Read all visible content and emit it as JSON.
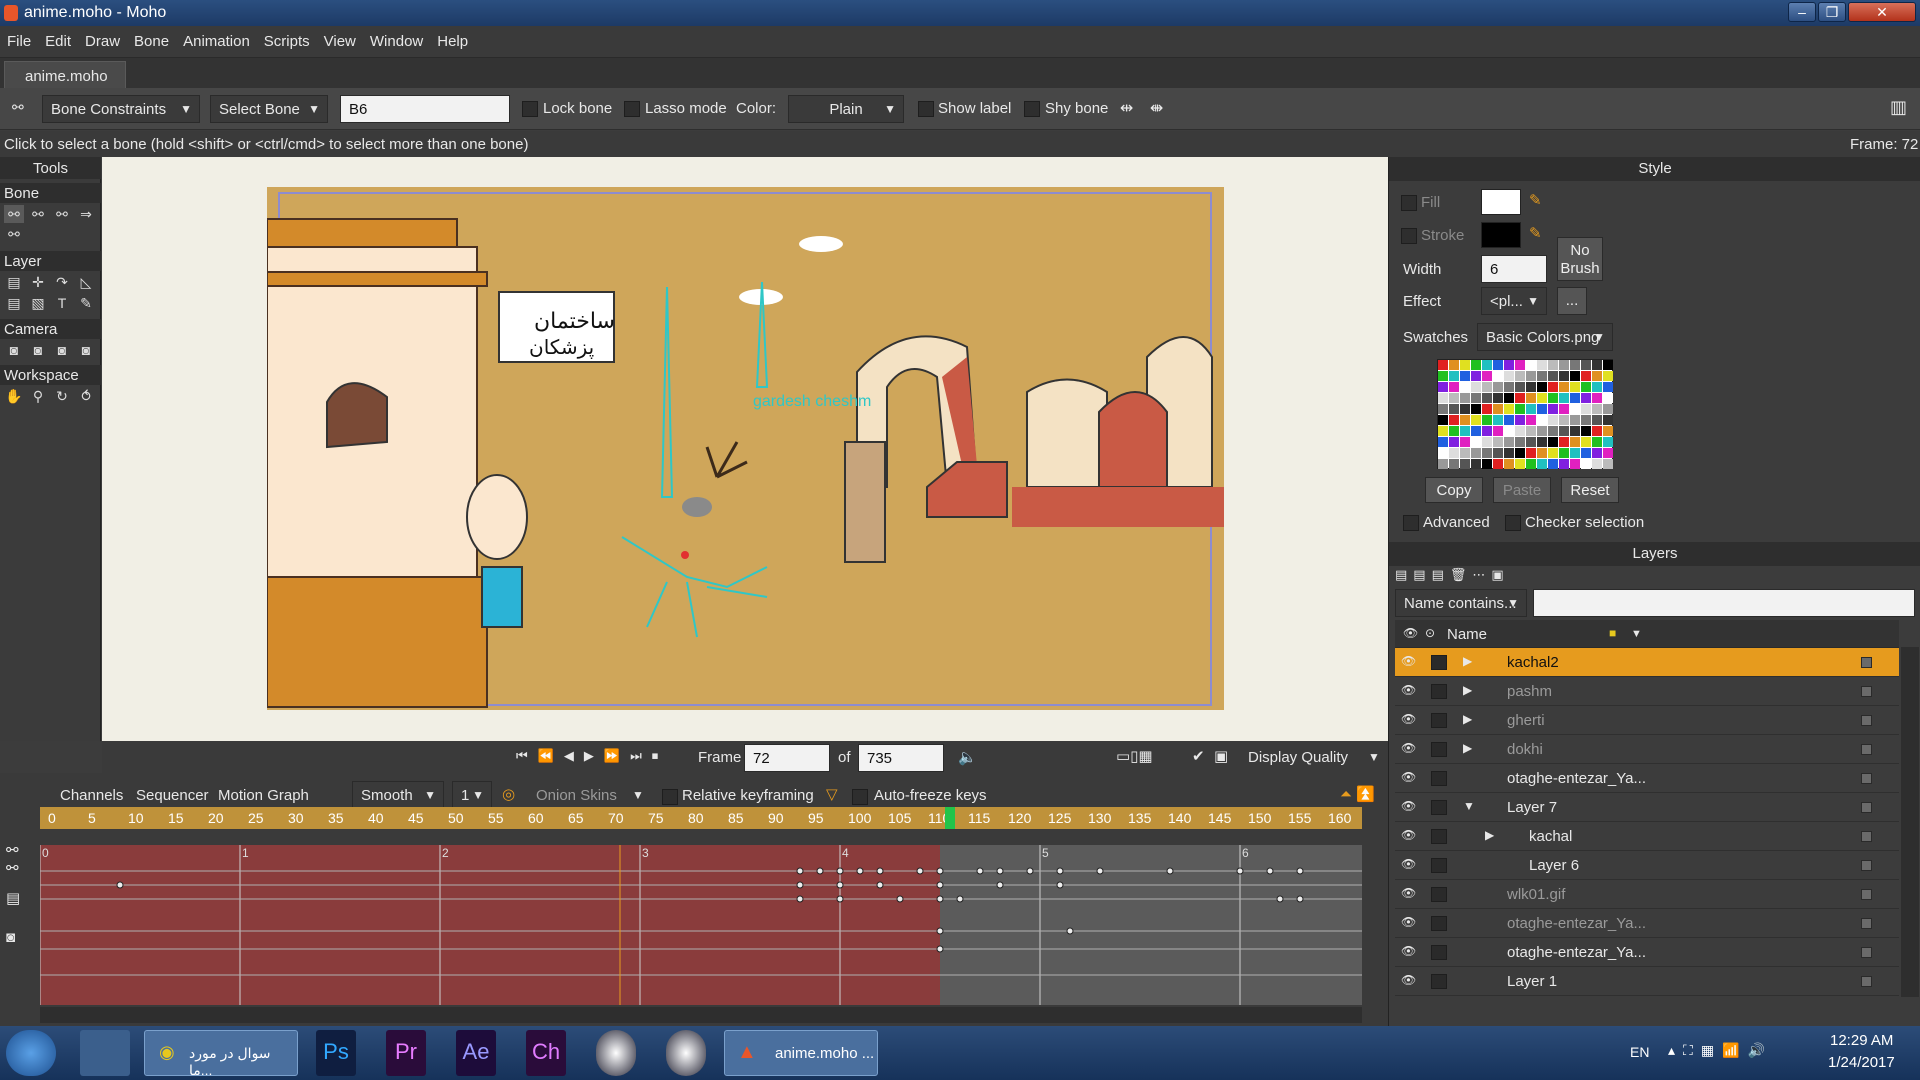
{
  "window": {
    "title": "anime.moho - Moho"
  },
  "menu": [
    "File",
    "Edit",
    "Draw",
    "Bone",
    "Animation",
    "Scripts",
    "View",
    "Window",
    "Help"
  ],
  "doc_tab": "anime.moho",
  "toolbar": {
    "bone_constraints": "Bone Constraints",
    "select_bone": "Select Bone",
    "bone_name": "B6",
    "lock_bone": "Lock bone",
    "lasso_mode": "Lasso mode",
    "color_label": "Color:",
    "color_value": "Plain",
    "show_label": "Show label",
    "shy_bone": "Shy bone"
  },
  "status": {
    "hint": "Click to select a bone (hold <shift> or <ctrl/cmd> to select more than one bone)",
    "frame": "Frame: 72"
  },
  "tools": {
    "title": "Tools",
    "sections": [
      "Bone",
      "Layer",
      "Camera",
      "Workspace"
    ]
  },
  "scene": {
    "sign_text_1": "ساختمان",
    "sign_text_2": "پزشکان",
    "bone_label": "gardesh cheshm"
  },
  "playbar": {
    "frame_label": "Frame",
    "frame_value": "72",
    "of_label": "of",
    "total": "735",
    "display_quality": "Display Quality"
  },
  "timeline": {
    "tabs": [
      "Channels",
      "Sequencer",
      "Motion Graph"
    ],
    "interp": "Smooth",
    "interp_num": "1",
    "onion_skins": "Onion Skins",
    "relative_keyframing": "Relative keyframing",
    "auto_freeze": "Auto-freeze keys",
    "ruler_ticks": [
      "0",
      "5",
      "10",
      "15",
      "20",
      "25",
      "30",
      "35",
      "40",
      "45",
      "50",
      "55",
      "60",
      "65",
      "70",
      "75",
      "80",
      "85",
      "90",
      "95",
      "100",
      "105",
      "110",
      "115",
      "120",
      "125",
      "130",
      "135",
      "140",
      "145",
      "150",
      "155",
      "160"
    ],
    "seconds": [
      "0",
      "1",
      "2",
      "3",
      "4",
      "5",
      "6"
    ]
  },
  "style": {
    "title": "Style",
    "fill": "Fill",
    "stroke": "Stroke",
    "width_label": "Width",
    "width_value": "6",
    "no_brush": "No Brush",
    "effect_label": "Effect",
    "effect_value": "<pl...",
    "effect_more": "...",
    "swatches_label": "Swatches",
    "swatches_value": "Basic Colors.png",
    "copy": "Copy",
    "paste": "Paste",
    "reset": "Reset",
    "advanced": "Advanced",
    "checker": "Checker selection"
  },
  "layers": {
    "title": "Layers",
    "filter": "Name contains...",
    "col_name": "Name",
    "items": [
      {
        "name": "kachal2",
        "active": true,
        "dim": false
      },
      {
        "name": "pashm",
        "active": false,
        "dim": true
      },
      {
        "name": "gherti",
        "active": false,
        "dim": true
      },
      {
        "name": "dokhi",
        "active": false,
        "dim": true
      },
      {
        "name": "otaghe-entezar_Ya...",
        "active": false,
        "dim": false
      },
      {
        "name": "Layer 7",
        "active": false,
        "dim": false
      },
      {
        "name": "kachal",
        "active": false,
        "dim": false
      },
      {
        "name": "Layer 6",
        "active": false,
        "dim": false
      },
      {
        "name": "wlk01.gif",
        "active": false,
        "dim": true
      },
      {
        "name": "otaghe-entezar_Ya...",
        "active": false,
        "dim": true
      },
      {
        "name": "otaghe-entezar_Ya...",
        "active": false,
        "dim": false
      },
      {
        "name": "Layer 1",
        "active": false,
        "dim": false
      }
    ]
  },
  "taskbar": {
    "chrome_label": "سوال در مورد ما...",
    "moho_label": "anime.moho ...",
    "apps": [
      "Ps",
      "Pr",
      "Ae",
      "Ch"
    ],
    "lang": "EN",
    "time": "12:29 AM",
    "date": "1/24/2017"
  },
  "colors": {
    "accent": "#e69b1e",
    "ruler": "#bf923a",
    "track": "#8a3c3c",
    "scene": "#cfa65a"
  }
}
